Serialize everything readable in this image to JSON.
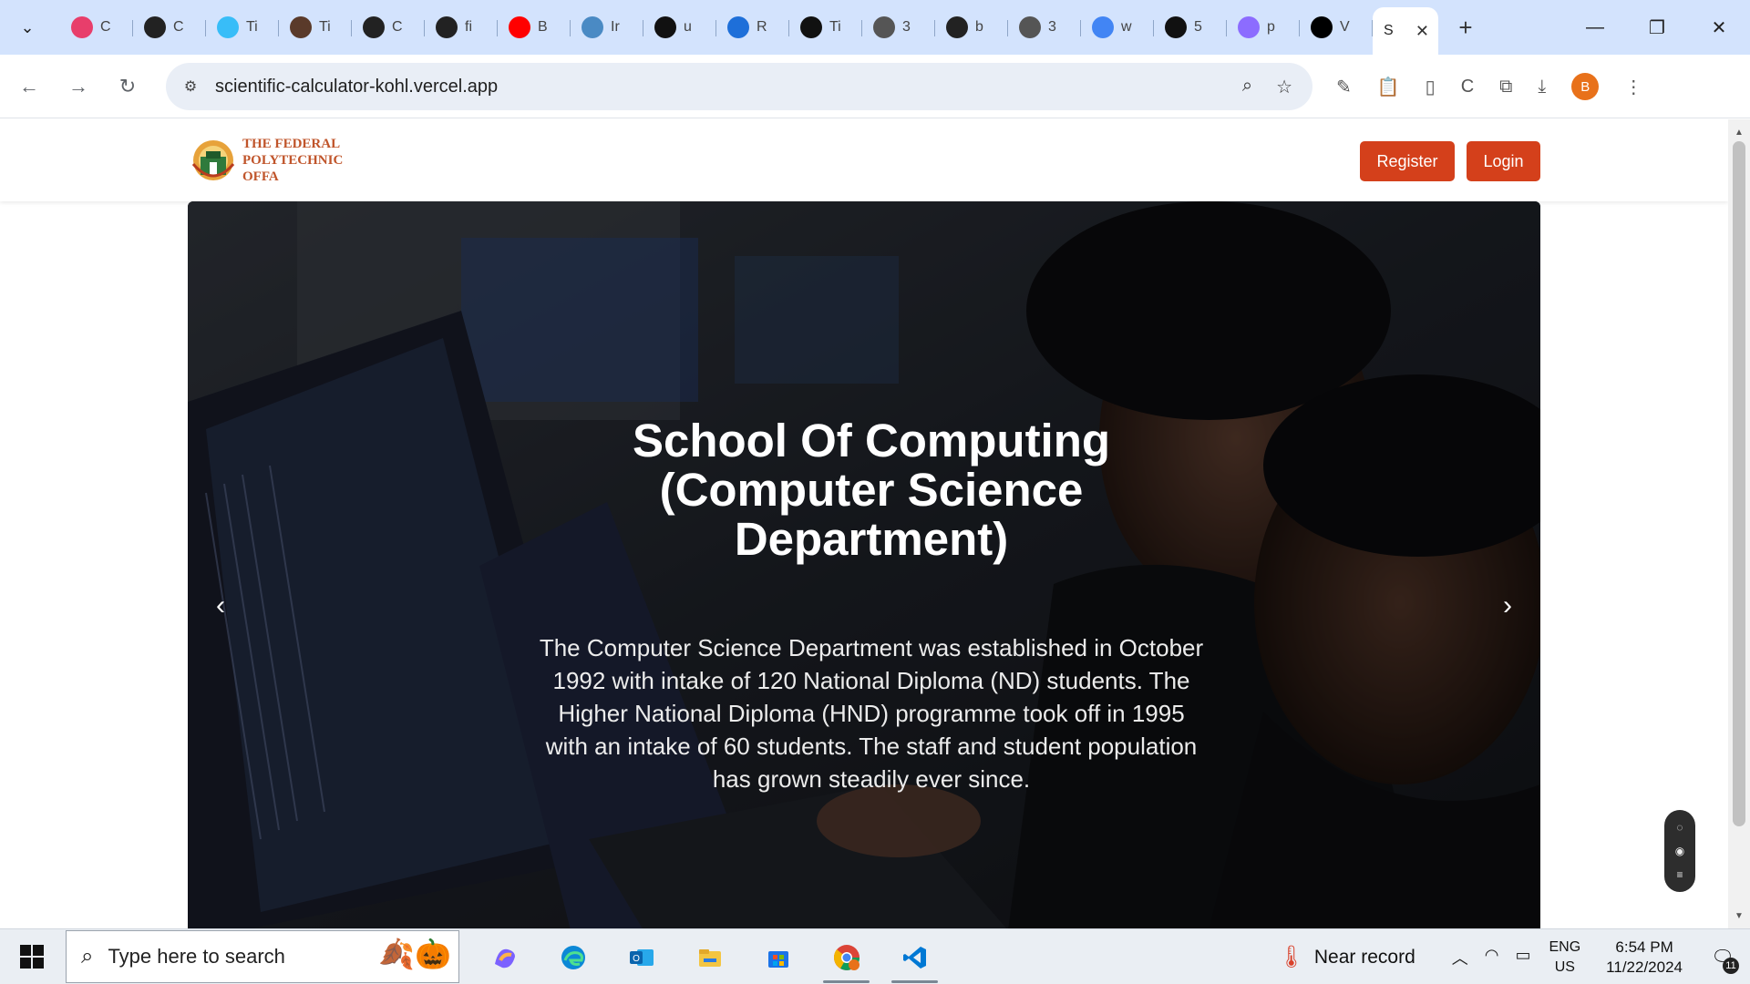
{
  "browser": {
    "tabs": [
      {
        "letter": "C",
        "icon": "canva-icon",
        "color": "#e83e6b"
      },
      {
        "letter": "C",
        "icon": "chatgpt-icon",
        "color": "#222222"
      },
      {
        "letter": "Ti",
        "icon": "tailwind-icon",
        "color": "#38bdf8"
      },
      {
        "letter": "Ti",
        "icon": "bear-icon",
        "color": "#5a3a2a"
      },
      {
        "letter": "C",
        "icon": "github-icon",
        "color": "#222222"
      },
      {
        "letter": "fi",
        "icon": "github-icon",
        "color": "#222222"
      },
      {
        "letter": "B",
        "icon": "youtube-icon",
        "color": "#ff0000"
      },
      {
        "letter": "Ir",
        "icon": "globe-icon",
        "color": "#4a8ac4"
      },
      {
        "letter": "u",
        "icon": "terminal-icon",
        "color": "#111111"
      },
      {
        "letter": "R",
        "icon": "mui-icon",
        "color": "#1e6fd9"
      },
      {
        "letter": "Ti",
        "icon": "medium-icon",
        "color": "#111111"
      },
      {
        "letter": "3",
        "icon": "globe-icon",
        "color": "#555555"
      },
      {
        "letter": "b",
        "icon": "github-icon",
        "color": "#222222"
      },
      {
        "letter": "3",
        "icon": "globe-icon",
        "color": "#555555"
      },
      {
        "letter": "w",
        "icon": "google-icon",
        "color": "#4285f4"
      },
      {
        "letter": "5",
        "icon": "upwork-icon",
        "color": "#111111"
      },
      {
        "letter": "p",
        "icon": "vite-icon",
        "color": "#8c6cff"
      },
      {
        "letter": "V",
        "icon": "vercel-icon",
        "color": "#000000"
      }
    ],
    "active_tab": {
      "letter": "S",
      "close": "✕"
    },
    "new_tab": "+",
    "url": "scientific-calculator-kohl.vercel.app",
    "profile_initial": "B"
  },
  "site": {
    "logo_lines": [
      "THE FEDERAL",
      "POLYTECHNIC",
      "OFFA"
    ],
    "register_label": "Register",
    "login_label": "Login",
    "hero": {
      "title": "School Of Computing (Computer Science Department)",
      "description": "The Computer Science Department was established in October 1992 with intake of 120 National Diploma (ND) students. The Higher National Diploma (HND) programme took off in 1995 with an intake of 60 students. The staff and student population has grown steadily ever since.",
      "prev": "‹",
      "next": "›"
    }
  },
  "taskbar": {
    "search_placeholder": "Type here to search",
    "apps": [
      "copilot-icon",
      "edge-icon",
      "outlook-icon",
      "file-explorer-icon",
      "microsoft-store-icon",
      "chrome-icon",
      "vscode-icon"
    ],
    "weather_text": "Near record",
    "lang_top": "ENG",
    "lang_bottom": "US",
    "time": "6:54 PM",
    "date": "11/22/2024",
    "notification_count": "11"
  },
  "colors": {
    "tabstrip": "#d3e3fd",
    "brand_button": "#d4401b",
    "logo_text": "#c0552b"
  }
}
